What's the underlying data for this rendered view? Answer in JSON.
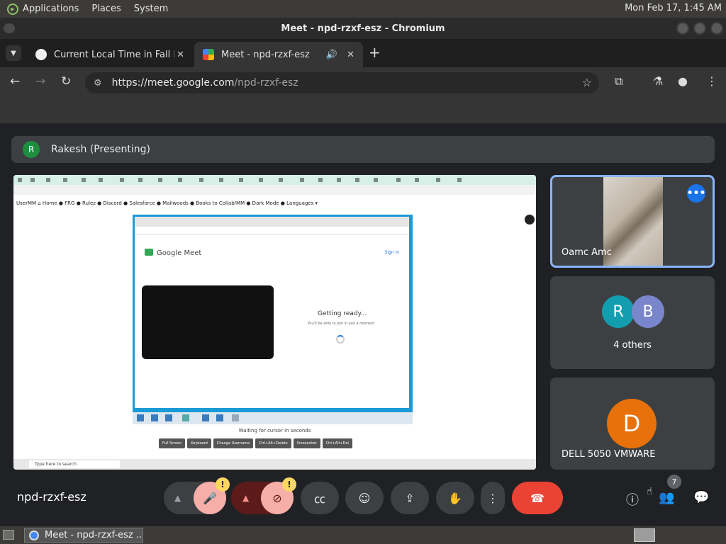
{
  "os_panel": {
    "menus": [
      "Applications",
      "Places",
      "System"
    ],
    "clock": "Mon Feb 17,  1:45 AM"
  },
  "window": {
    "title": "Meet - npd-rzxf-esz - Chromium"
  },
  "tabs": [
    {
      "label": "Current Local Time in Fall Ri",
      "icon": "clock-favicon-icon"
    },
    {
      "label": "Meet - npd-rzxf-esz",
      "icon": "google-meet-favicon-icon"
    }
  ],
  "address_bar": {
    "host": "https://meet.google.com",
    "path": "/npd-rzxf-esz"
  },
  "meet": {
    "presenter_initial": "R",
    "presenter_label": "Rakesh (Presenting)",
    "shared_screen": {
      "bookmarks": "UserMM   ⌂ Home   ● FRG   ● Rulez   ● Discord   ● Salesforce   ● Mailwoods   ● Books to Collab/MM   ● Dark Mode   ● Languages ▾",
      "inner_brand": "Google Meet",
      "inner_signin": "Sign in",
      "getting_ready": "Getting ready...",
      "getting_ready_sub": "You'll be able to join in just a moment",
      "waiting": "Waiting for cursor in seconds",
      "buttons": [
        "Full Screen",
        "Keyboard",
        "Change Username",
        "Ctrl+Alt+Delete",
        "Screenshot",
        "Ctrl+Alt+Del"
      ],
      "search": "Type here to search"
    },
    "participants": [
      {
        "name": "Oamc Amc"
      },
      {
        "others_label": "4 others",
        "initials": [
          "R",
          "B"
        ]
      },
      {
        "name": "DELL 5050 VMWARE",
        "initial": "D"
      }
    ],
    "meeting_code": "npd-rzxf-esz",
    "people_count": "7",
    "colors": {
      "accent": "#8ab4f8",
      "end_call": "#ea4335",
      "avatar_orange": "#e8710a",
      "avatar_green": "#1e8e3e",
      "avatar_teal": "#129eaf",
      "avatar_purple": "#7986cb"
    }
  },
  "taskbar": {
    "task_label": "Meet - npd-rzxf-esz ..."
  }
}
